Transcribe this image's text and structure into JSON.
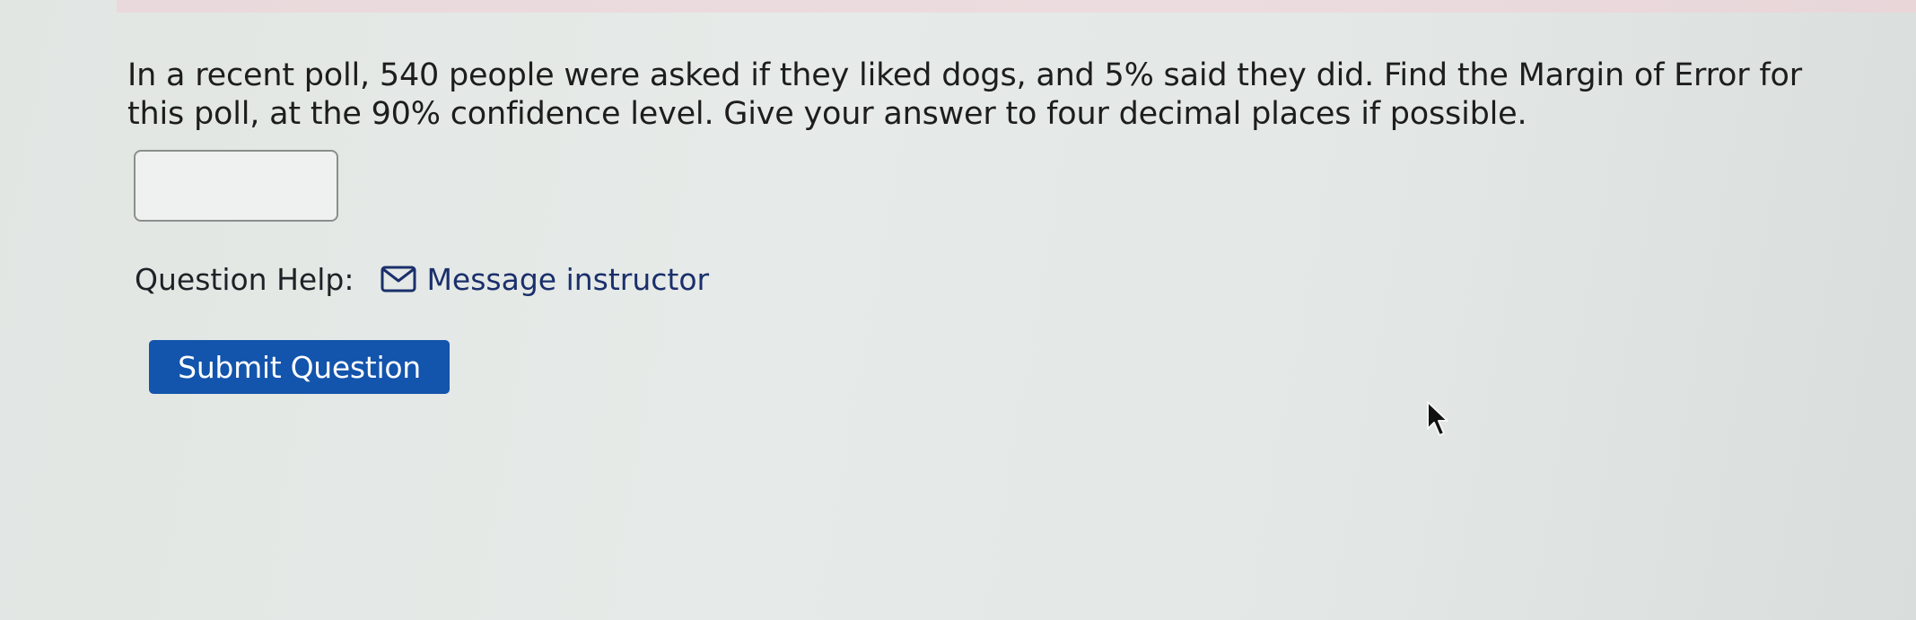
{
  "question": {
    "text": "In a recent poll, 540 people were asked if they liked dogs, and 5% said they did. Find the Margin of Error for this poll, at the 90% confidence level. Give your answer to four decimal places if possible."
  },
  "answer": {
    "value": "",
    "placeholder": ""
  },
  "help": {
    "label": "Question Help:",
    "link_label": "Message instructor",
    "icon": "mail-icon"
  },
  "submit": {
    "label": "Submit Question",
    "color": "#1354ac"
  },
  "colors": {
    "link": "#1a2f6b",
    "text": "#1d1d1d"
  }
}
